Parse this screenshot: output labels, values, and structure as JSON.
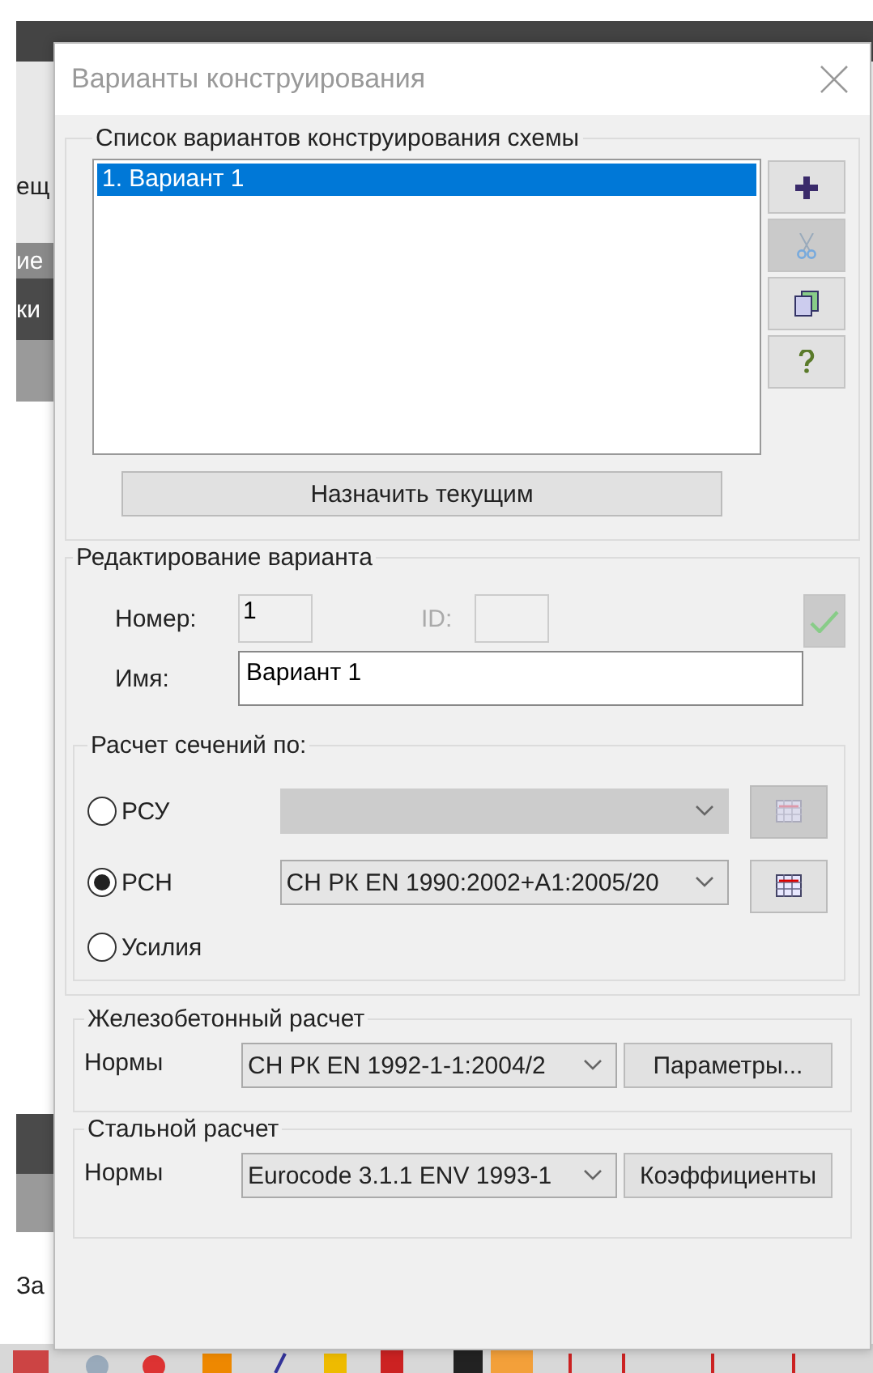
{
  "background": {
    "side_texts": [
      {
        "text": "ещ",
        "kind": "toolbar"
      },
      {
        "text": "ие",
        "kind": "gray"
      },
      {
        "text": "ки",
        "kind": "dark"
      },
      {
        "text": "За",
        "kind": "plain"
      }
    ]
  },
  "dialog": {
    "title": "Варианты конструирования",
    "list_group": {
      "legend": "Список вариантов конструирования схемы",
      "items": [
        {
          "label": "1. Вариант 1",
          "selected": true
        }
      ],
      "side_buttons": [
        {
          "kind": "add",
          "disabled": false
        },
        {
          "kind": "cut",
          "disabled": true
        },
        {
          "kind": "copy",
          "disabled": false
        },
        {
          "kind": "help",
          "disabled": false
        }
      ],
      "set_current": "Назначить текущим"
    },
    "edit_group": {
      "legend": "Редактирование варианта",
      "apply_disabled": true,
      "number": {
        "label": "Номер:",
        "value": "1"
      },
      "id": {
        "label": "ID:",
        "disabled": true
      },
      "name": {
        "label": "Имя:",
        "value": "Вариант 1"
      },
      "sections": {
        "legend": "Расчет сечений по:",
        "options": [
          {
            "label": "РСУ",
            "selected": false,
            "combo": {
              "disabled": true
            }
          },
          {
            "label": "РСН",
            "selected": true,
            "combo": {
              "value": "СН РК EN 1990:2002+A1:2005/20",
              "disabled": false
            }
          },
          {
            "label": "Усилия",
            "selected": false
          }
        ]
      }
    },
    "norm_groups": [
      {
        "legend": "Железобетонный  расчет",
        "label": "Нормы",
        "value": "СН РК EN 1992-1-1:2004/2",
        "button": "Параметры..."
      },
      {
        "legend": "Стальной расчет",
        "label": "Нормы",
        "value": "Eurocode 3.1.1 ENV 1993-1",
        "button": "Коэффициенты"
      }
    ]
  }
}
